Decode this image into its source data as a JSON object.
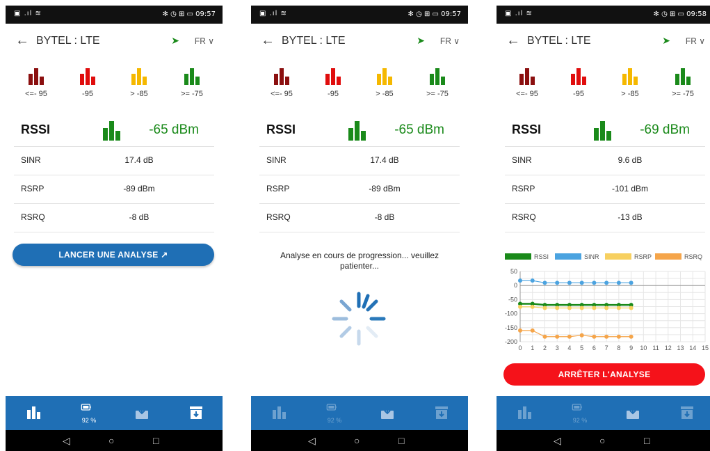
{
  "colors": {
    "dark_red": "#8b0f0f",
    "red": "#e00d0d",
    "orange": "#f5b800",
    "green": "#1a8a1a",
    "blue": "#1f6fb5",
    "stop_red": "#f5121a",
    "sinr_blue": "#4ba3e0",
    "rsrp_yellow": "#f7d060",
    "rsrq_orange": "#f5a54a"
  },
  "screens": [
    {
      "status_left": "▣ .ıl ≋",
      "status_right": "✻ ◷ ⊞ ▭ 09:57",
      "title": "BYTEL : LTE",
      "lang": "FR",
      "legend": [
        "<=- 95",
        "-95",
        "> -85",
        ">= -75"
      ],
      "rssi_label": "RSSI",
      "rssi_value": "-65 dBm",
      "metrics": [
        {
          "label": "SINR",
          "value": "17.4 dB"
        },
        {
          "label": "RSRP",
          "value": "-89 dBm"
        },
        {
          "label": "RSRQ",
          "value": "-8 dB"
        }
      ],
      "button": "LANCER UNE ANALYSE",
      "battery": "92 %"
    },
    {
      "status_left": "▣ .ıl ≋",
      "status_right": "✻ ◷ ⊞ ▭ 09:57",
      "title": "BYTEL : LTE",
      "lang": "FR",
      "legend": [
        "<=- 95",
        "-95",
        "> -85",
        ">= -75"
      ],
      "rssi_label": "RSSI",
      "rssi_value": "-65 dBm",
      "metrics": [
        {
          "label": "SINR",
          "value": "17.4 dB"
        },
        {
          "label": "RSRP",
          "value": "-89 dBm"
        },
        {
          "label": "RSRQ",
          "value": "-8 dB"
        }
      ],
      "progress": "Analyse en cours de progression... veuillez patienter...",
      "battery": "92 %"
    },
    {
      "status_left": "▣ .ıl ≋",
      "status_right": "✻ ◷ ⊞ ▭ 09:58",
      "title": "BYTEL : LTE",
      "lang": "FR",
      "legend": [
        "<=- 95",
        "-95",
        "> -85",
        ">= -75"
      ],
      "rssi_label": "RSSI",
      "rssi_value": "-69 dBm",
      "metrics": [
        {
          "label": "SINR",
          "value": "9.6 dB"
        },
        {
          "label": "RSRP",
          "value": "-101 dBm"
        },
        {
          "label": "RSRQ",
          "value": "-13 dB"
        }
      ],
      "button": "ARRÊTER L'ANALYSE",
      "battery": "92 %"
    }
  ],
  "chart_data": {
    "type": "line",
    "x": [
      0,
      1,
      2,
      3,
      4,
      5,
      6,
      7,
      8,
      9
    ],
    "xticks": [
      "0",
      "1",
      "2",
      "3",
      "4",
      "5",
      "6",
      "7",
      "8",
      "9",
      "10",
      "11",
      "12",
      "13",
      "14",
      "15"
    ],
    "yticks": [
      "50",
      "0",
      "-50",
      "-100",
      "-150",
      "-200"
    ],
    "xlim": [
      0,
      15
    ],
    "ylim": [
      -200,
      50
    ],
    "grid": true,
    "legend_position": "top",
    "series": [
      {
        "name": "RSSI",
        "values": [
          -65,
          -65,
          -69,
          -69,
          -69,
          -69,
          -69,
          -69,
          -69,
          -69
        ]
      },
      {
        "name": "SINR",
        "values": [
          17.4,
          17.4,
          9.6,
          9.6,
          9.6,
          9.6,
          9.6,
          9.6,
          9.6,
          9.6
        ]
      },
      {
        "name": "RSRP",
        "values": [
          -76,
          -76,
          -80,
          -80,
          -80,
          -80,
          -80,
          -80,
          -80,
          -80
        ]
      },
      {
        "name": "RSRQ",
        "values": [
          -160,
          -160,
          -182,
          -182,
          -182,
          -177,
          -182,
          -182,
          -182,
          -182
        ]
      }
    ]
  }
}
